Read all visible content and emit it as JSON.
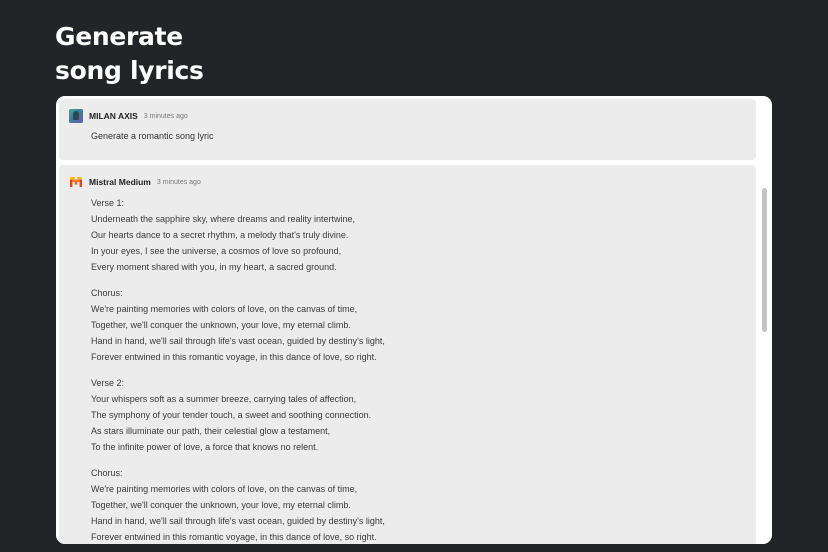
{
  "page": {
    "title_line1": "Generate",
    "title_line2": "song lyrics"
  },
  "user_message": {
    "avatar_icon": "user-avatar-icon",
    "sender": "MILAN AXIS",
    "time": "3 minutes ago",
    "text": "Generate a romantic song lyric"
  },
  "bot_message": {
    "avatar_icon": "mistral-logo-icon",
    "sender": "Mistral Medium",
    "time": "3 minutes ago",
    "stanzas": [
      {
        "heading": "Verse 1:",
        "lines": [
          "Underneath the sapphire sky, where dreams and reality intertwine,",
          "Our hearts dance to a secret rhythm, a melody that's truly divine.",
          "In your eyes, I see the universe, a cosmos of love so profound,",
          "Every moment shared with you, in my heart, a sacred ground."
        ]
      },
      {
        "heading": "Chorus:",
        "lines": [
          "We're painting memories with colors of love, on the canvas of time,",
          "Together, we'll conquer the unknown, your love, my eternal climb.",
          "Hand in hand, we'll sail through life's vast ocean, guided by destiny's light,",
          "Forever entwined in this romantic voyage, in this dance of love, so right."
        ]
      },
      {
        "heading": "Verse 2:",
        "lines": [
          "Your whispers soft as a summer breeze, carrying tales of affection,",
          "The symphony of your tender touch, a sweet and soothing connection.",
          "As stars illuminate our path, their celestial glow a testament,",
          "To the infinite power of love, a force that knows no relent."
        ]
      },
      {
        "heading": "Chorus:",
        "lines": [
          "We're painting memories with colors of love, on the canvas of time,",
          "Together, we'll conquer the unknown, your love, my eternal climb.",
          "Hand in hand, we'll sail through life's vast ocean, guided by destiny's light,",
          "Forever entwined in this romantic voyage, in this dance of love, so right."
        ]
      }
    ]
  },
  "colors": {
    "background": "#232428",
    "panel": "#ffffff",
    "message_bg": "#ececec",
    "mistral_orange": "#f7791e"
  }
}
